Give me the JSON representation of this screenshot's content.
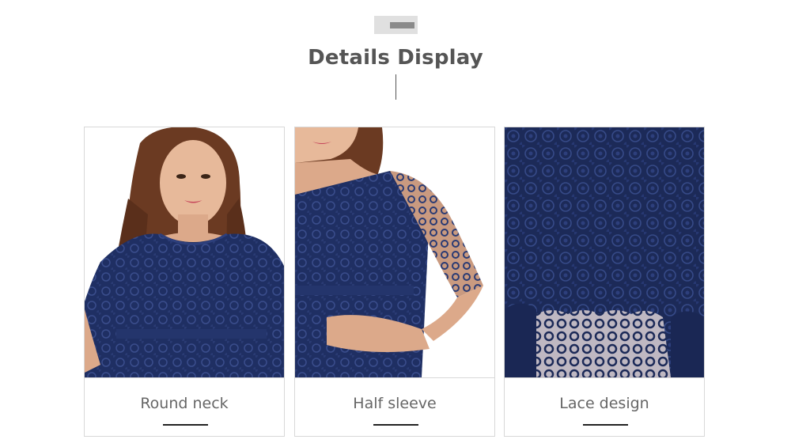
{
  "header": {
    "title": "Details Display"
  },
  "cards": [
    {
      "caption": "Round neck",
      "image": "model-round-neck-photo"
    },
    {
      "caption": "Half sleeve",
      "image": "model-half-sleeve-photo"
    },
    {
      "caption": "Lace design",
      "image": "lace-fabric-closeup-photo"
    }
  ],
  "colors": {
    "title": "#555555",
    "caption": "#666666",
    "dress_navy": "#1d2c5e",
    "card_border": "#d8d8d8"
  }
}
